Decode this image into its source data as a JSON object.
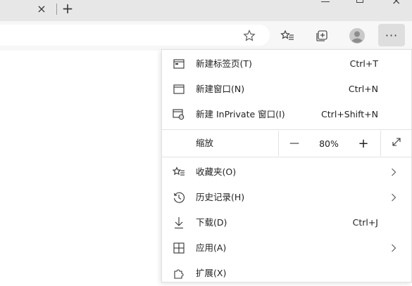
{
  "titlebar": {
    "tab_close": "×",
    "new_tab": "+",
    "close_glyph": "×"
  },
  "toolbar": {
    "more_label": "···",
    "icons": [
      "star-outline-icon",
      "favorites-icon",
      "collections-icon",
      "profile-icon",
      "more-icon"
    ]
  },
  "menu": {
    "items": [
      {
        "label": "新建标签页(T)",
        "shortcut": "Ctrl+T",
        "icon": "new-tab-icon"
      },
      {
        "label": "新建窗口(N)",
        "shortcut": "Ctrl+N",
        "icon": "new-window-icon"
      },
      {
        "label": "新建 InPrivate 窗口(I)",
        "shortcut": "Ctrl+Shift+N",
        "icon": "inprivate-icon"
      }
    ],
    "zoom": {
      "label": "缩放",
      "minus": "—",
      "value": "80%",
      "plus": "+"
    },
    "items2": [
      {
        "label": "收藏夹(O)",
        "shortcut": "",
        "icon": "favorites-icon",
        "submenu": true
      },
      {
        "label": "历史记录(H)",
        "shortcut": "",
        "icon": "history-icon",
        "submenu": true
      },
      {
        "label": "下载(D)",
        "shortcut": "Ctrl+J",
        "icon": "download-icon",
        "submenu": false
      },
      {
        "label": "应用(A)",
        "shortcut": "",
        "icon": "apps-icon",
        "submenu": true
      },
      {
        "label": "扩展(X)",
        "shortcut": "",
        "icon": "extensions-icon",
        "submenu": false
      }
    ]
  },
  "colors": {
    "titlebar_bg": "#e7e7e7",
    "toolbar_bg": "#f7f7f7",
    "menu_bg": "#ffffff",
    "more_button_active": "#dedede"
  }
}
